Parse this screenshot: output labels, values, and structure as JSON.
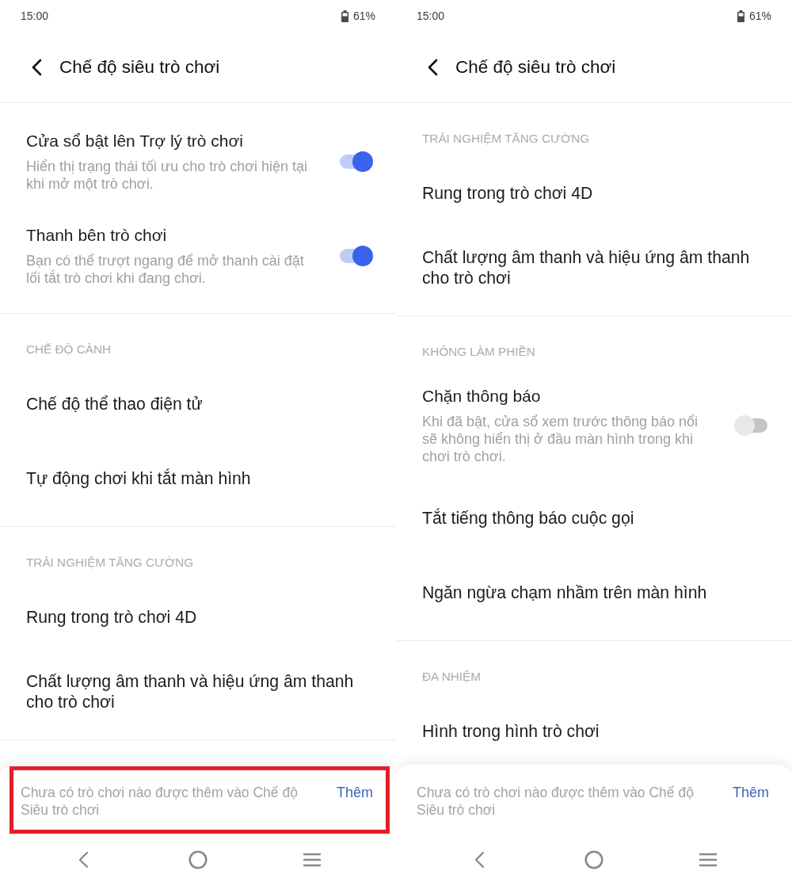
{
  "screens": [
    {
      "status_bar": {
        "time": "15:00",
        "battery": "61%"
      },
      "header": {
        "title": "Chế độ siêu trò chơi"
      },
      "sections": [
        {
          "items": [
            {
              "kind": "switch",
              "title": "Cửa sổ bật lên Trợ lý trò chơi",
              "description": "Hiển thị trạng thái tối ưu cho trò chơi hiện tại khi mở một trò chơi.",
              "on": true
            },
            {
              "kind": "switch",
              "title": "Thanh bên trò chơi",
              "description": "Bạn có thể trượt ngang để mở thanh cài đặt lối tắt trò chơi khi đang chơi.",
              "on": true
            }
          ]
        },
        {
          "header": "CHẾ ĐỘ CẢNH",
          "items": [
            {
              "kind": "link",
              "title": "Chế độ thể thao điện tử"
            },
            {
              "kind": "link",
              "title": "Tự động chơi khi tắt màn hình"
            }
          ]
        },
        {
          "header": "TRẢI NGHIỆM TĂNG CƯỜNG",
          "items": [
            {
              "kind": "link",
              "title": "Rung trong trò chơi 4D"
            },
            {
              "kind": "link",
              "title": "Chất lượng âm thanh và hiệu ứng âm thanh cho trò chơi"
            }
          ]
        }
      ],
      "bottom_banner": {
        "message": "Chưa có trò chơi nào được thêm vào Chế độ Siêu trò chơi",
        "action": "Thêm",
        "highlighted": true
      }
    },
    {
      "status_bar": {
        "time": "15:00",
        "battery": "61%"
      },
      "header": {
        "title": "Chế độ siêu trò chơi"
      },
      "sections": [
        {
          "header": "TRẢI NGHIỆM TĂNG CƯỜNG",
          "items": [
            {
              "kind": "link",
              "title": "Rung trong trò chơi 4D"
            },
            {
              "kind": "link",
              "title": "Chất lượng âm thanh và hiệu ứng âm thanh cho trò chơi"
            }
          ]
        },
        {
          "header": "KHÔNG LÀM PHIỀN",
          "items": [
            {
              "kind": "switch",
              "title": "Chặn thông báo",
              "description": "Khi đã bật, cửa sổ xem trước thông báo nổi sẽ không hiển thị ở đầu màn hình trong khi chơi trò chơi.",
              "on": false
            },
            {
              "kind": "link",
              "title": "Tắt tiếng thông báo cuộc gọi"
            },
            {
              "kind": "link",
              "title": "Ngăn ngừa chạm nhầm trên màn hình"
            }
          ]
        },
        {
          "header": "ĐA NHIỆM",
          "items": [
            {
              "kind": "link",
              "title": "Hình trong hình trò chơi"
            }
          ]
        }
      ],
      "bottom_banner": {
        "message": "Chưa có trò chơi nào được thêm vào Chế độ Siêu trò chơi",
        "action": "Thêm",
        "highlighted": false
      }
    }
  ]
}
